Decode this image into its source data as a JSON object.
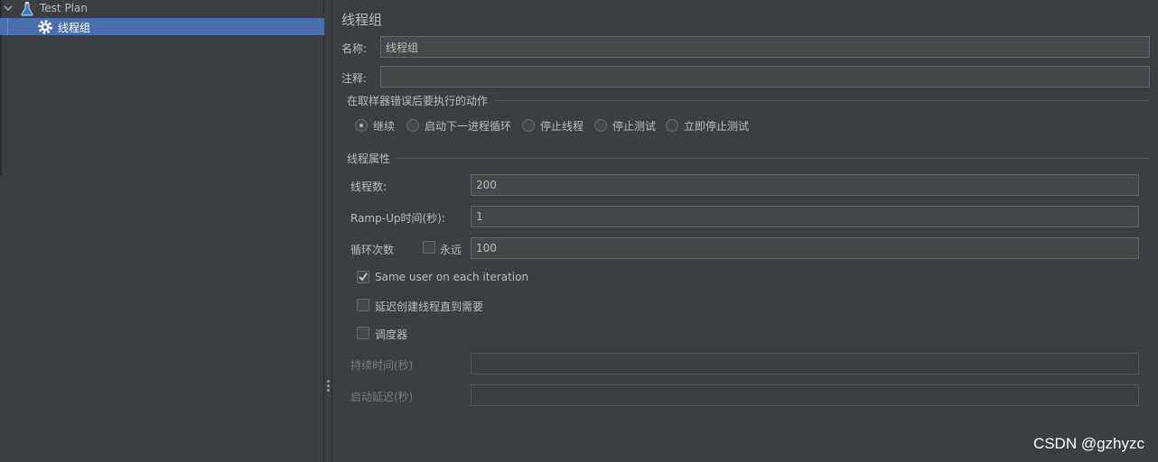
{
  "tree": {
    "test_plan": "Test Plan",
    "thread_group": "线程组"
  },
  "panel": {
    "title": "线程组",
    "name_label": "名称:",
    "name_value": "线程组",
    "comment_label": "注释:",
    "comment_value": "",
    "error_action_section": "在取样器错误后要执行的动作",
    "actions": [
      {
        "label": "继续",
        "checked": true
      },
      {
        "label": "启动下一进程循环",
        "checked": false
      },
      {
        "label": "停止线程",
        "checked": false
      },
      {
        "label": "停止测试",
        "checked": false
      },
      {
        "label": "立即停止测试",
        "checked": false
      }
    ],
    "thread_props_section": "线程属性",
    "threads_label": "线程数:",
    "threads_value": "200",
    "rampup_label": "Ramp-Up时间(秒):",
    "rampup_value": "1",
    "loop_label": "循环次数",
    "forever_label": "永远",
    "loop_value": "100",
    "same_user_label": "Same user on each iteration",
    "delay_create_label": "延迟创建线程直到需要",
    "scheduler_label": "调度器",
    "duration_label": "持续时间(秒)",
    "duration_value": "",
    "startup_delay_label": "启动延迟(秒)",
    "startup_delay_value": ""
  },
  "watermark": "CSDN @gzhyzc",
  "colors": {
    "background": "#3c3f41",
    "selection": "#4b6eaf",
    "field": "#45494a",
    "text": "#bbbbbb"
  }
}
